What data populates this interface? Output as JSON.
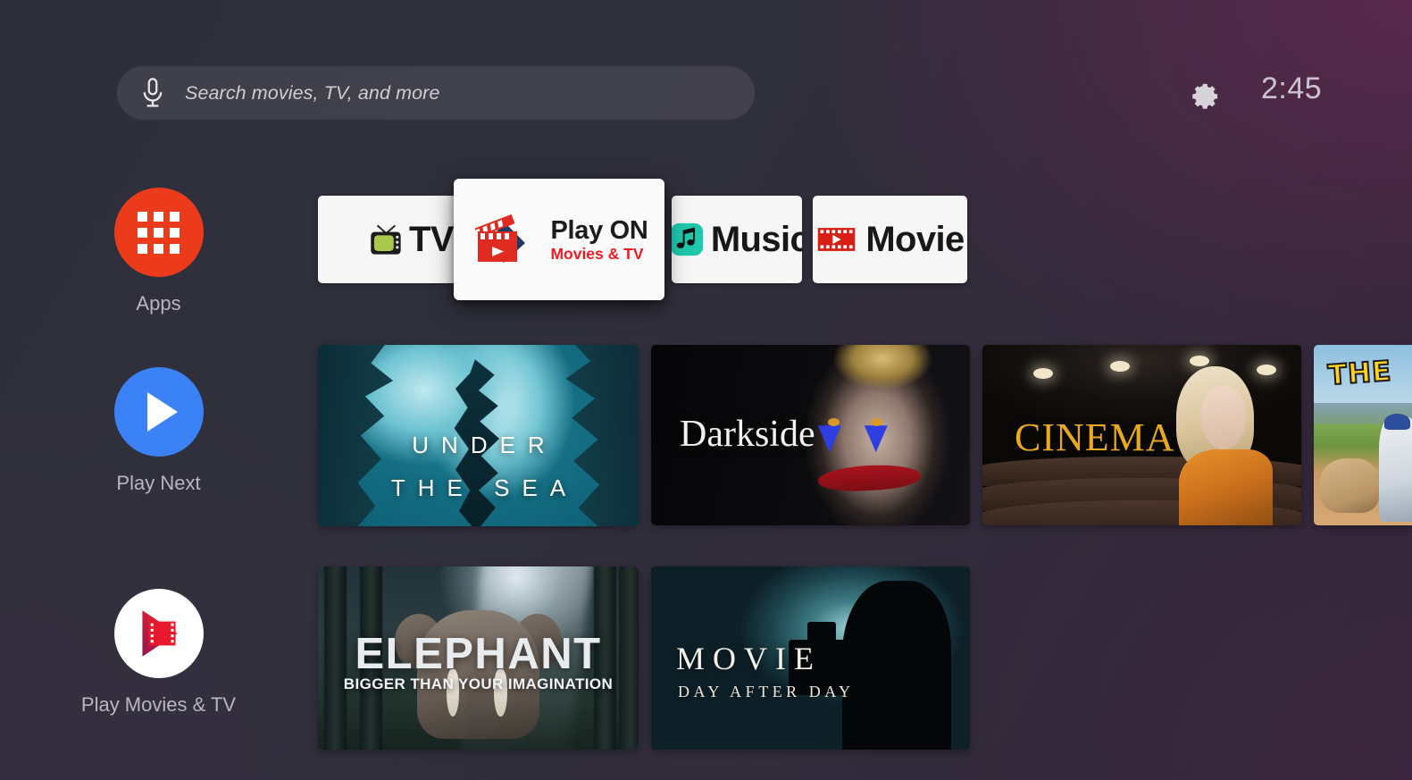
{
  "topbar": {
    "search": {
      "placeholder": "Search movies, TV, and more",
      "mic_icon": "microphone-icon"
    },
    "settings_icon": "gear-icon",
    "clock": "2:45"
  },
  "sidebar": {
    "items": [
      {
        "label": "Apps",
        "icon": "apps-grid-icon",
        "color": "#ec3b1b"
      },
      {
        "label": "Play Next",
        "icon": "play-triangle-icon",
        "color": "#3b82f6"
      },
      {
        "label": "Play Movies & TV",
        "icon": "play-movies-logo-icon",
        "color": "#ffffff"
      }
    ]
  },
  "app_row": {
    "focused_label": "Play Movies & TV",
    "apps": [
      {
        "name": "TV",
        "icon": "retro-tv-icon",
        "focused": false
      },
      {
        "name": "Play ON",
        "subtitle": "Movies & TV",
        "icon": "clapperboard-play-icon",
        "focused": true
      },
      {
        "name": "Music",
        "icon": "music-note-icon",
        "focused": false
      },
      {
        "name": "Movie",
        "icon": "film-strip-play-icon",
        "focused": false
      }
    ]
  },
  "content": {
    "rows": [
      {
        "tiles": [
          {
            "title": "UNDER",
            "title2": "THE SEA"
          },
          {
            "title": "Darkside"
          },
          {
            "title": "CINEMA"
          },
          {
            "title": "THE"
          }
        ]
      },
      {
        "tiles": [
          {
            "title": "ELEPHANT",
            "subtitle": "BIGGER THAN YOUR IMAGINATION"
          },
          {
            "title": "MOVIE",
            "subtitle": "DAY AFTER DAY"
          }
        ]
      }
    ]
  },
  "colors": {
    "accent_red": "#ec3b1b",
    "accent_blue": "#3b82f6",
    "playon_red": "#ee1c22",
    "music_teal": "#1fc8ac",
    "cinema_gold": "#e8a91d"
  }
}
